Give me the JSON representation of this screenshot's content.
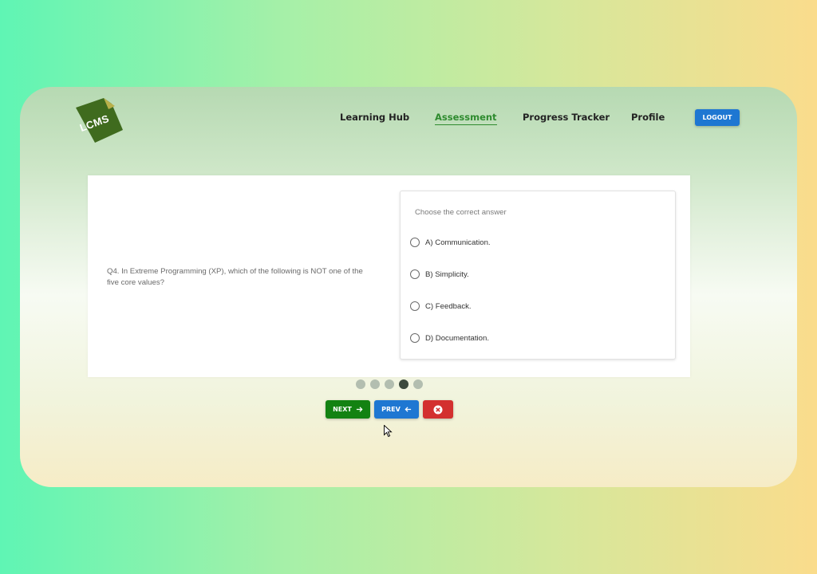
{
  "app": {
    "logo_text": "LCMS",
    "brand_color": "#3f6b1e",
    "accent_color": "#2e8b2e"
  },
  "nav": {
    "items": [
      {
        "label": "Learning Hub",
        "active": false
      },
      {
        "label": "Assessment",
        "active": true
      },
      {
        "label": "Progress Tracker",
        "active": false
      },
      {
        "label": "Profile",
        "active": false
      }
    ],
    "logout_label": "LOGOUT"
  },
  "quiz": {
    "question": "Q4. In Extreme Programming (XP), which of the following is NOT one of the five core values?",
    "hint": "Choose the correct answer",
    "options": [
      {
        "label": "A) Communication."
      },
      {
        "label": "B) Simplicity."
      },
      {
        "label": "C) Feedback."
      },
      {
        "label": "D) Documentation."
      }
    ],
    "total_questions": 5,
    "current_question": 4
  },
  "controls": {
    "next_label": "NEXT",
    "prev_label": "PREV",
    "next_icon": "arrow-right-icon",
    "prev_icon": "arrow-left-icon",
    "close_icon": "close-circle-icon",
    "next_color": "#138212",
    "prev_color": "#1e77d2",
    "close_color": "#d3302f"
  }
}
